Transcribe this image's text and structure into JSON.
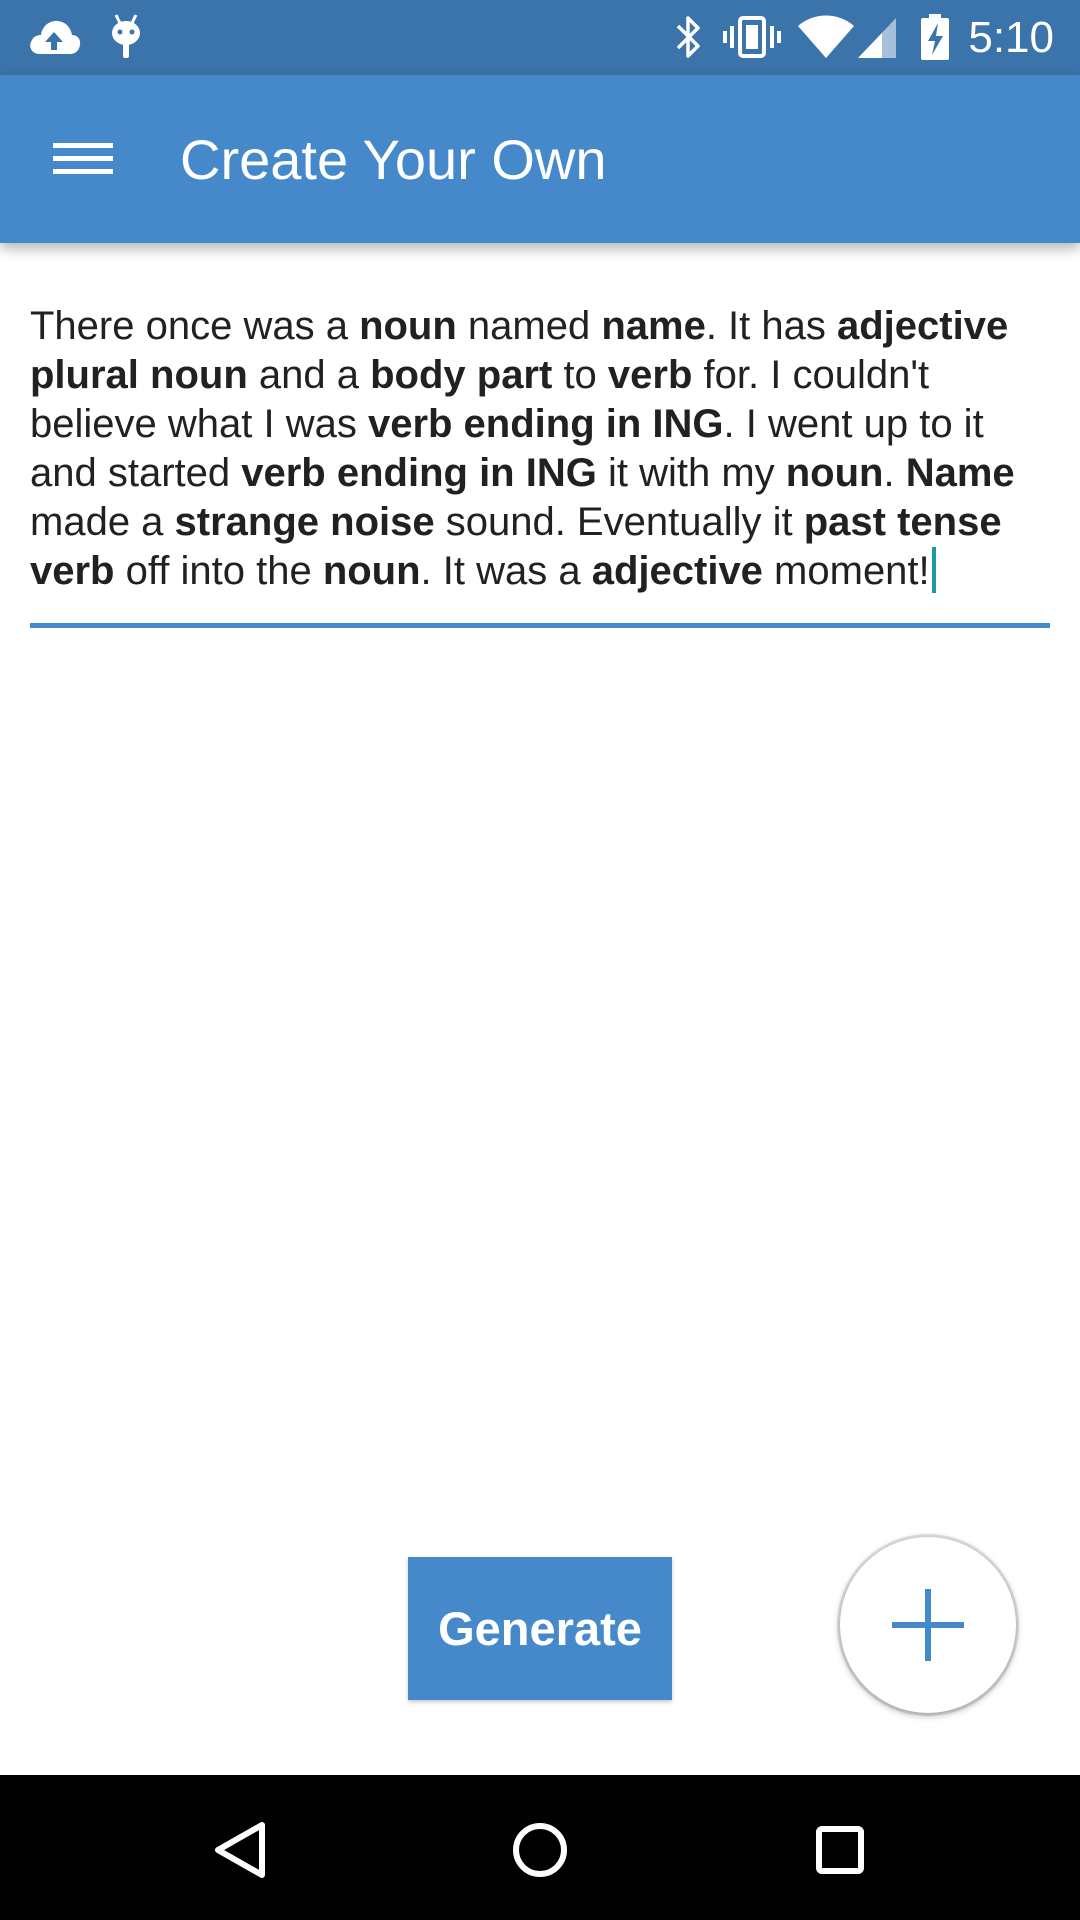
{
  "status_bar": {
    "time": "5:10",
    "icons": [
      "cloud-upload-icon",
      "android-debug-icon",
      "bluetooth-icon",
      "vibrate-icon",
      "wifi-icon",
      "cell-signal-icon",
      "battery-charging-icon"
    ]
  },
  "app_bar": {
    "title": "Create Your Own",
    "menu_icon": "hamburger-menu-icon",
    "color": "#4589cb"
  },
  "story": {
    "segments": [
      {
        "text": "There once was a ",
        "bold": false
      },
      {
        "text": "noun",
        "bold": true
      },
      {
        "text": " named ",
        "bold": false
      },
      {
        "text": "name",
        "bold": true
      },
      {
        "text": ". It has ",
        "bold": false
      },
      {
        "text": "adjective plural noun",
        "bold": true
      },
      {
        "text": " and a ",
        "bold": false
      },
      {
        "text": "body part",
        "bold": true
      },
      {
        "text": " to ",
        "bold": false
      },
      {
        "text": "verb",
        "bold": true
      },
      {
        "text": " for. I couldn't believe what I was ",
        "bold": false
      },
      {
        "text": "verb ending in ING",
        "bold": true
      },
      {
        "text": ". I went up to it and started ",
        "bold": false
      },
      {
        "text": "verb ending in ING",
        "bold": true
      },
      {
        "text": " it with my ",
        "bold": false
      },
      {
        "text": "noun",
        "bold": true
      },
      {
        "text": ". ",
        "bold": false
      },
      {
        "text": "Name",
        "bold": true
      },
      {
        "text": " made a ",
        "bold": false
      },
      {
        "text": "strange noise",
        "bold": true
      },
      {
        "text": " sound. Eventually it ",
        "bold": false
      },
      {
        "text": "past tense verb",
        "bold": true
      },
      {
        "text": " off into the ",
        "bold": false
      },
      {
        "text": "noun",
        "bold": true
      },
      {
        "text": ". It was a ",
        "bold": false
      },
      {
        "text": "adjective",
        "bold": true
      },
      {
        "text": " moment!",
        "bold": false
      }
    ]
  },
  "actions": {
    "generate_label": "Generate",
    "add_icon": "plus-icon"
  },
  "nav_bar": {
    "icons": [
      "back-icon",
      "home-icon",
      "recents-icon"
    ]
  }
}
